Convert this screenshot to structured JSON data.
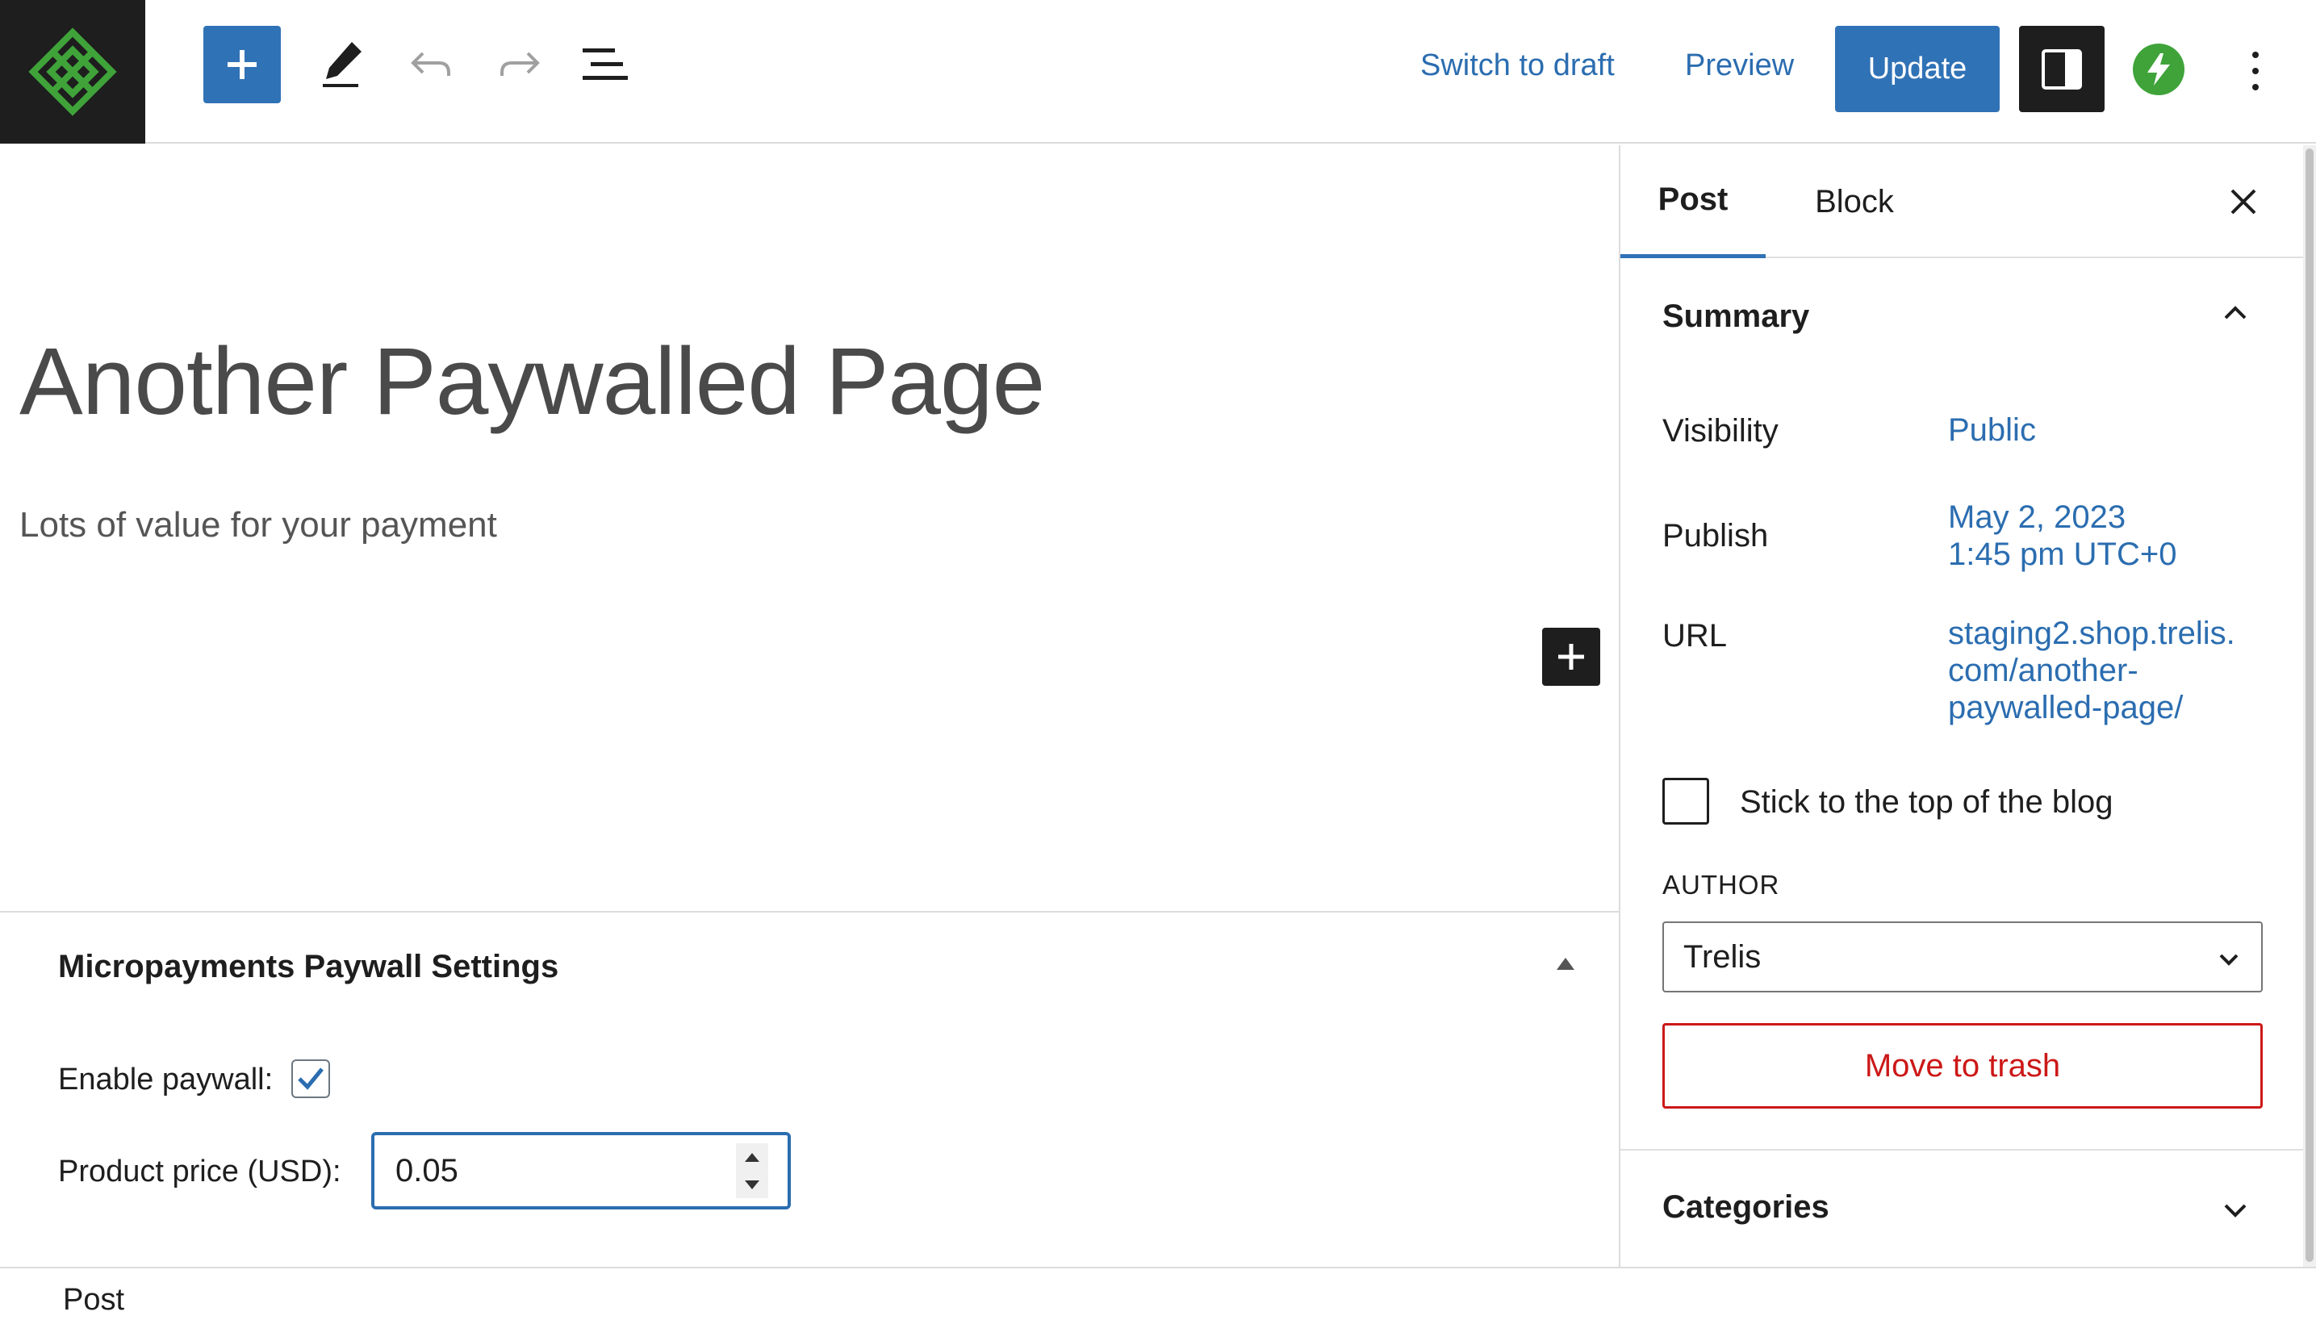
{
  "toolbar": {
    "switch_to_draft": "Switch to draft",
    "preview": "Preview",
    "update": "Update"
  },
  "post": {
    "title": "Another Paywalled Page",
    "paragraph": "Lots of value for your payment"
  },
  "metabox": {
    "title": "Micropayments Paywall Settings",
    "enable_paywall_label": "Enable paywall:",
    "enable_paywall_checked": true,
    "price_label": "Product price (USD):",
    "price_value": "0.05"
  },
  "sidebar": {
    "tabs": [
      "Post",
      "Block"
    ],
    "summary_title": "Summary",
    "visibility_label": "Visibility",
    "visibility_value": "Public",
    "publish_label": "Publish",
    "publish_date": "May 2, 2023",
    "publish_time": "1:45 pm UTC+0",
    "url_label": "URL",
    "url_line1": "staging2.shop.trelis.",
    "url_line2": "com/another-",
    "url_line3": "paywalled-page/",
    "sticky_label": "Stick to the top of the blog",
    "sticky_checked": false,
    "author_label": "AUTHOR",
    "author_value": "Trelis",
    "trash_label": "Move to trash",
    "categories_title": "Categories"
  },
  "footer": {
    "breadcrumb": "Post"
  },
  "colors": {
    "accent": "#3072b6",
    "link": "#2b6db0",
    "danger": "#cc1818",
    "logo_bg": "#1e1e1e",
    "logo_green": "#3fa33a",
    "jetpack_green": "#3fa33a"
  },
  "icons": [
    "site-logo-icon",
    "plus-icon",
    "pencil-icon",
    "undo-icon",
    "redo-icon",
    "list-view-icon",
    "sidebar-toggle-icon",
    "jetpack-bolt-icon",
    "more-vertical-icon",
    "close-icon",
    "chevron-up-icon",
    "chevron-down-icon",
    "checkmark-icon"
  ]
}
